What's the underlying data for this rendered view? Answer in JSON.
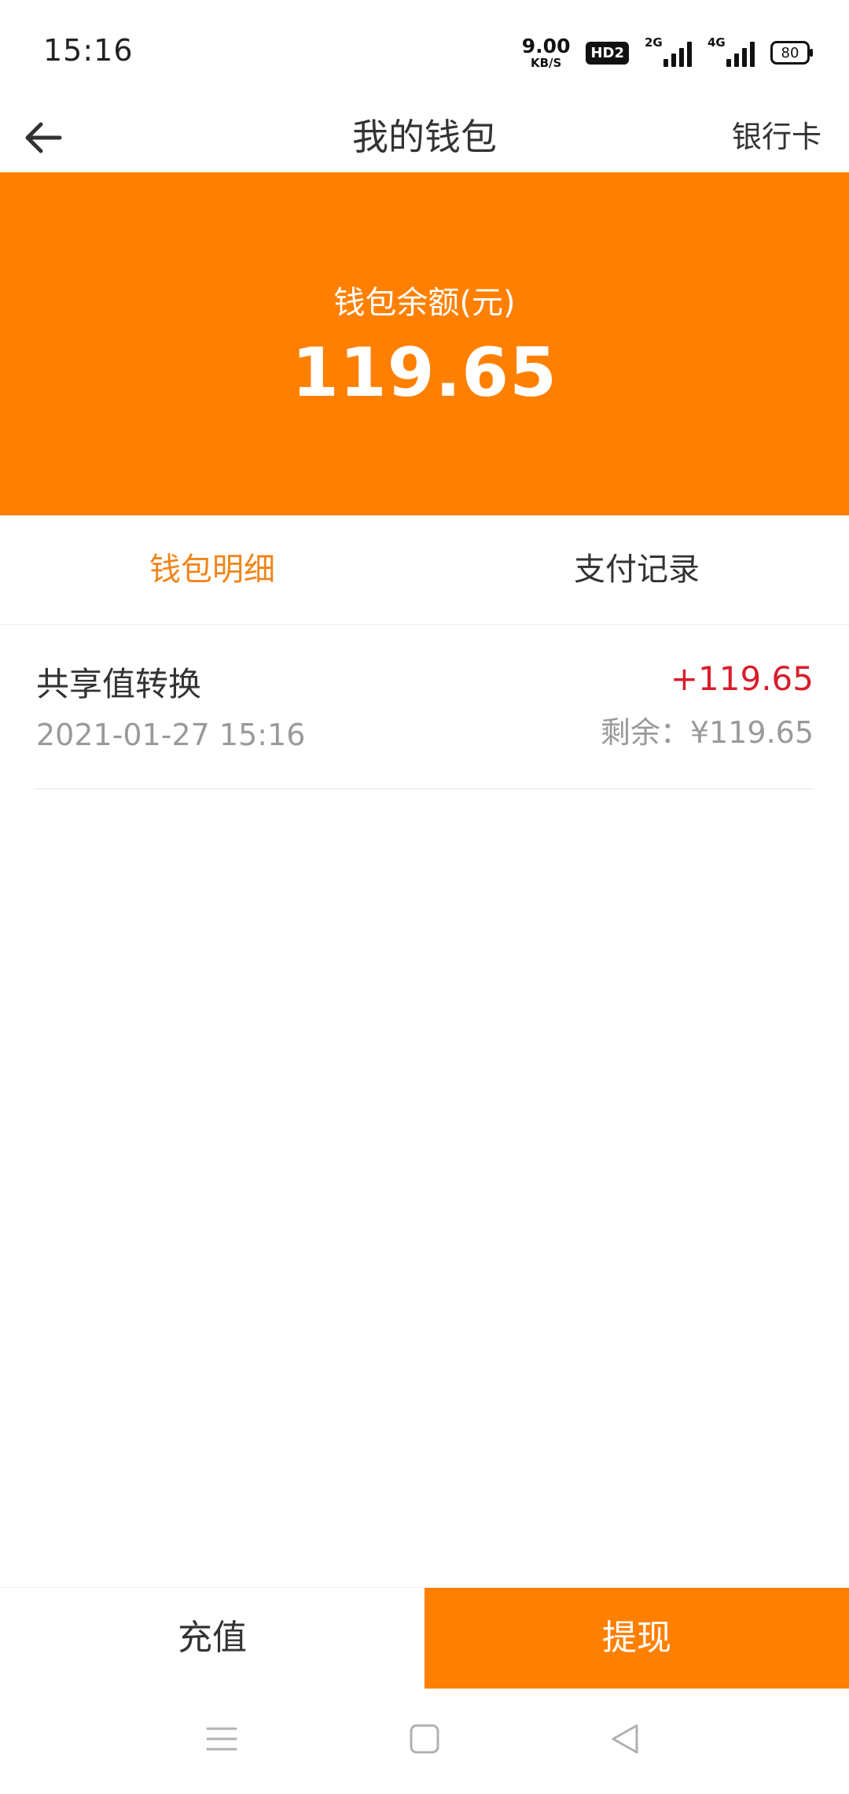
{
  "status_bar": {
    "time": "15:16",
    "net_speed_value": "9.00",
    "net_speed_unit": "KB/S",
    "hd_badge": "HD2",
    "signal_1_tag": "2G",
    "signal_2_tag": "4G",
    "battery": "80"
  },
  "header": {
    "title": "我的钱包",
    "right_link": "银行卡",
    "back_icon": "arrow-left-icon"
  },
  "balance": {
    "label": "钱包余额(元)",
    "value": "119.65"
  },
  "tabs": [
    {
      "label": "钱包明细",
      "active": true
    },
    {
      "label": "支付记录",
      "active": false
    }
  ],
  "transactions": [
    {
      "title": "共享值转换",
      "date": "2021-01-27 15:16",
      "amount": "+119.65",
      "remaining": "剩余：¥119.65"
    }
  ],
  "actions": {
    "recharge": "充值",
    "withdraw": "提现"
  },
  "colors": {
    "accent": "#ff8000",
    "tab_active": "#f08519",
    "amount_positive": "#d81e2c"
  }
}
